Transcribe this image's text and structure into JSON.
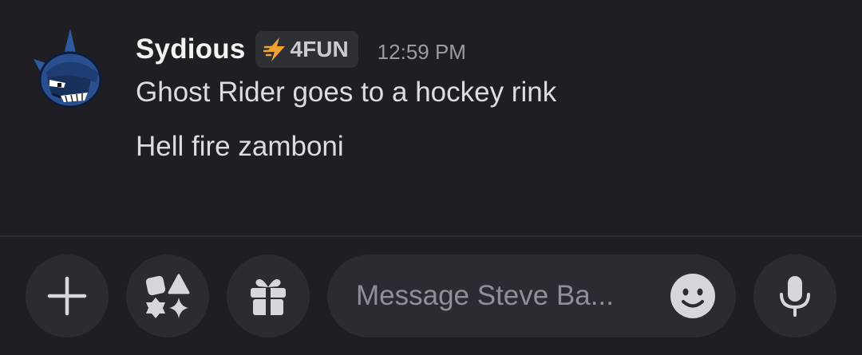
{
  "message": {
    "author": "Sydious",
    "tag": {
      "icon": "lightning-bolt-icon",
      "label": "4FUN",
      "color": "#f0a232"
    },
    "timestamp": "12:59 PM",
    "lines": [
      "Ghost Rider goes to a hockey rink",
      "Hell fire zamboni"
    ],
    "avatar_icon": "cartoon-avatar-icon"
  },
  "composer": {
    "placeholder": "Message Steve Ba...",
    "buttons": {
      "add": "plus-icon",
      "apps": "apps-icon",
      "gift": "gift-icon",
      "emoji": "smiley-icon",
      "mic": "microphone-icon"
    }
  },
  "colors": {
    "background": "#1f1f23",
    "surface": "#2b2c31",
    "text": "#dbdee1",
    "muted": "#9a9ca3"
  }
}
